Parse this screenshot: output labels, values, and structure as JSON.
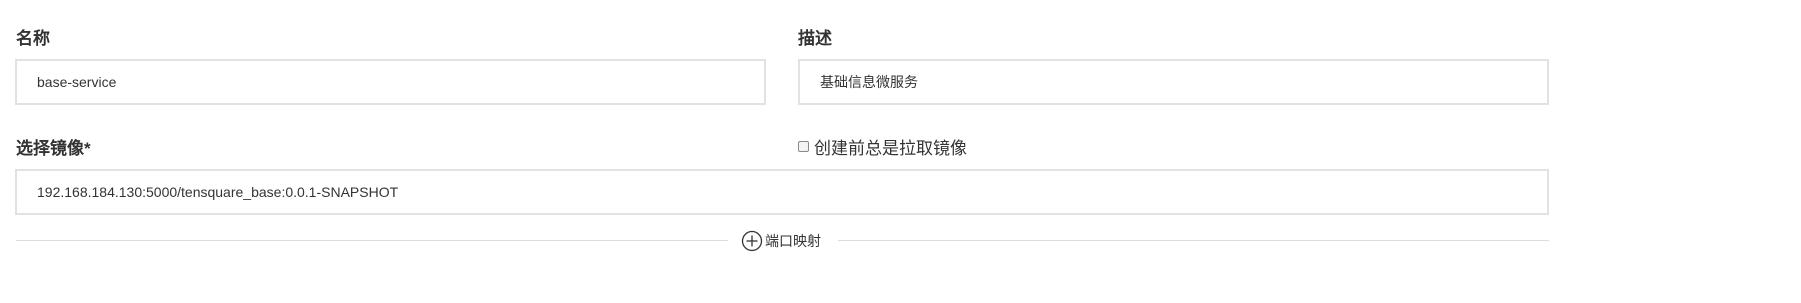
{
  "form": {
    "name": {
      "label": "名称",
      "value": "base-service"
    },
    "description": {
      "label": "描述",
      "value": "基础信息微服务"
    },
    "image": {
      "label": "选择镜像*",
      "value": "192.168.184.130:5000/tensquare_base:0.0.1-SNAPSHOT"
    },
    "pull_before_create": {
      "label": "创建前总是拉取镜像",
      "checked": false
    },
    "port_mapping": {
      "label": "端口映射",
      "icon": "plus-circle-icon"
    }
  },
  "colors": {
    "border": "#e2e2e2",
    "text": "#333333",
    "divider": "#dcdcdc"
  }
}
